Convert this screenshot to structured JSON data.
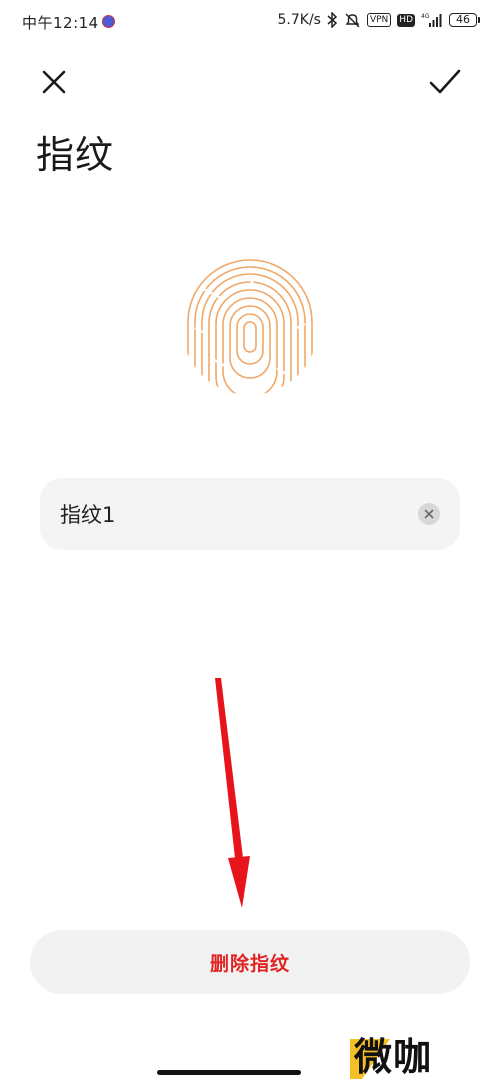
{
  "status_bar": {
    "time": "中午12:14",
    "net_speed": "5.7K/s",
    "vpn_badge": "VPN",
    "hd_badge": "HD",
    "network_type": "4G",
    "battery": "46"
  },
  "header": {
    "title": "指纹",
    "close_icon": "close-icon",
    "confirm_icon": "check-icon"
  },
  "fingerprint": {
    "icon": "fingerprint-icon",
    "color": "#F0A868"
  },
  "name_field": {
    "value": "指纹1",
    "clear_icon": "clear-icon"
  },
  "delete_button": {
    "label": "删除指纹",
    "color": "#E02424"
  },
  "annotation": {
    "arrow_color": "#E8141B"
  },
  "watermark": {
    "text": "微咖",
    "accent_color": "#F4B400"
  }
}
